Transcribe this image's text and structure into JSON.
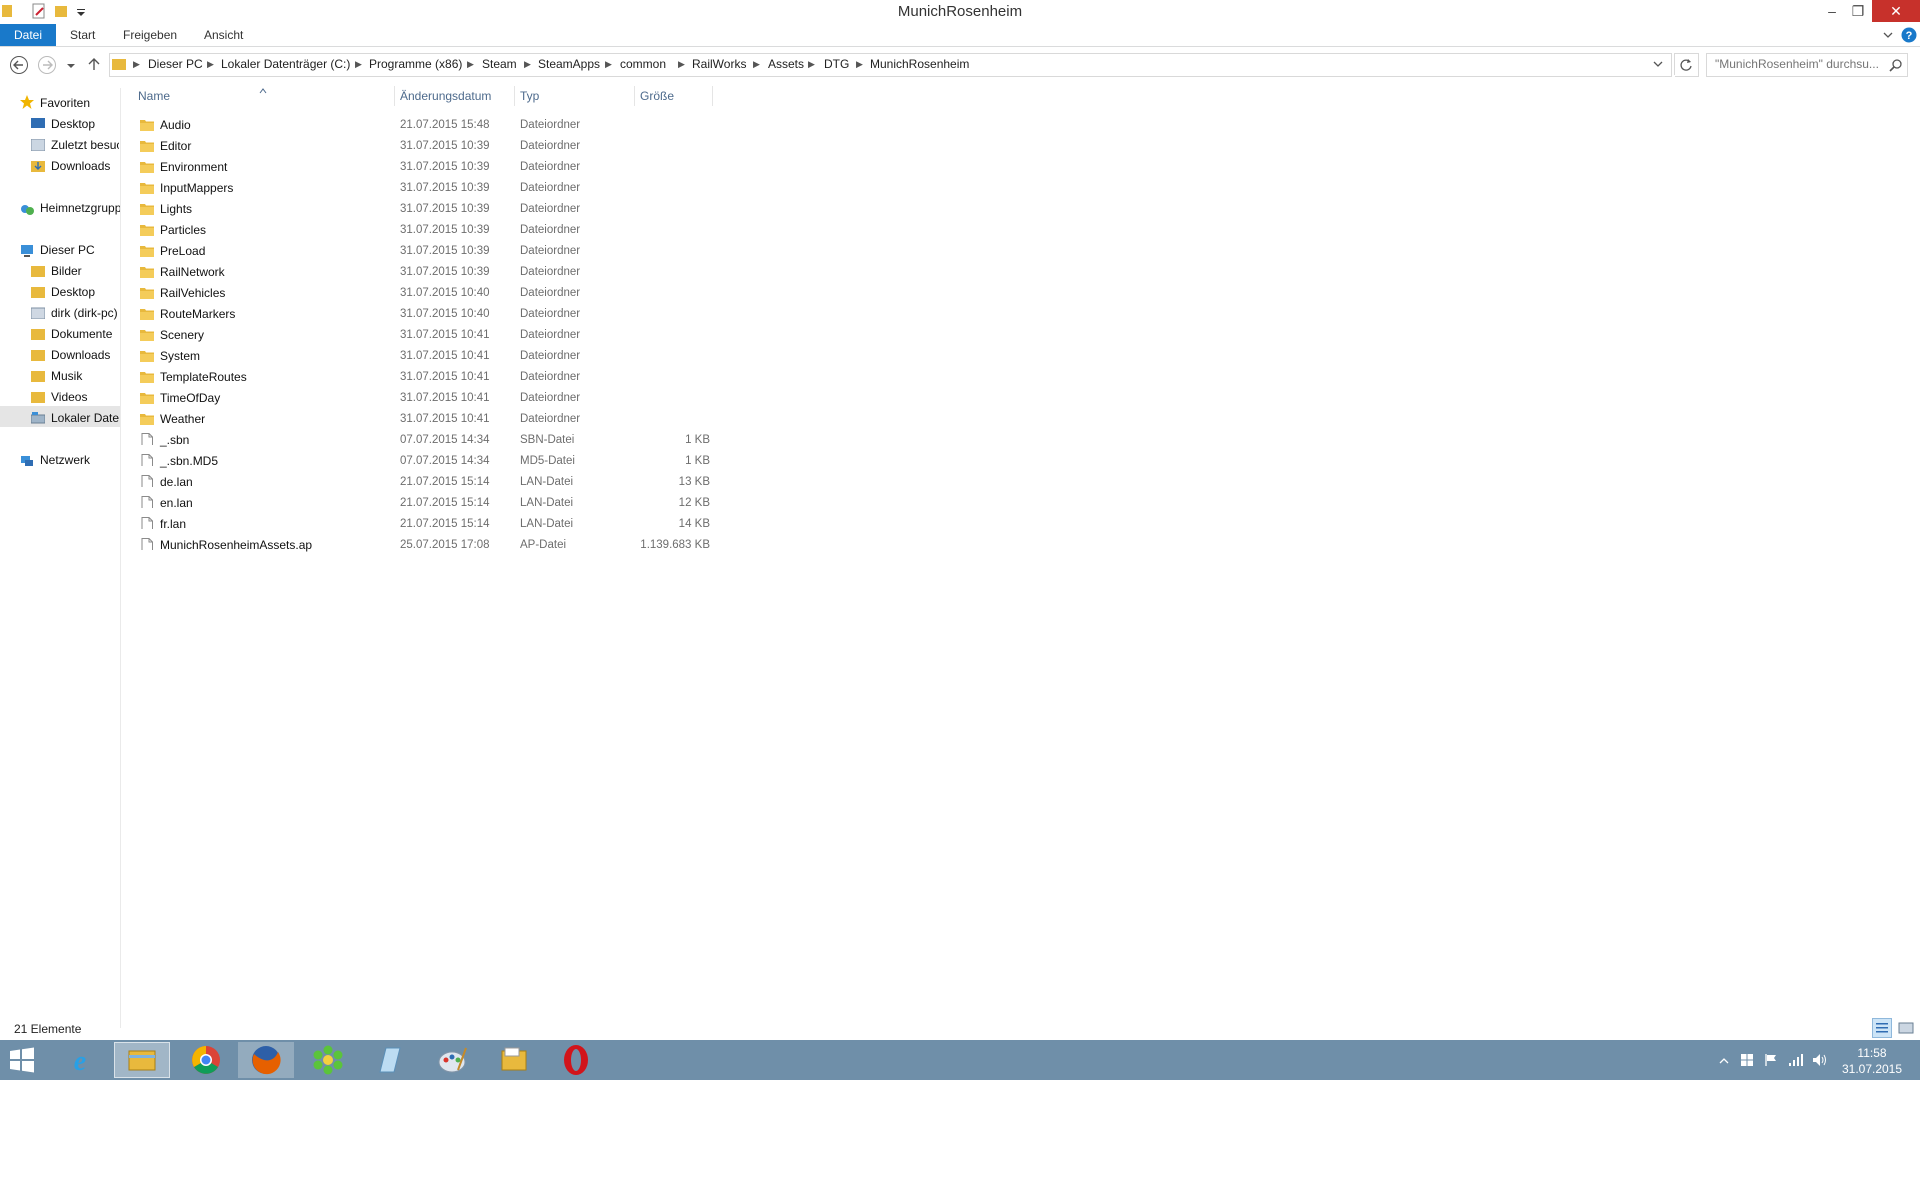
{
  "window": {
    "title": "MunichRosenheim"
  },
  "ribbon": {
    "tabs": [
      "Datei",
      "Start",
      "Freigeben",
      "Ansicht"
    ]
  },
  "address": {
    "crumbs": [
      "Dieser PC",
      "Lokaler Datenträger (C:)",
      "Programme (x86)",
      "Steam",
      "SteamApps",
      "common",
      "RailWorks",
      "Assets",
      "DTG",
      "MunichRosenheim"
    ]
  },
  "search": {
    "placeholder": "\"MunichRosenheim\" durchsu..."
  },
  "nav": {
    "favorites_label": "Favoriten",
    "favorites": [
      "Desktop",
      "Zuletzt besuc",
      "Downloads"
    ],
    "homegroup": "Heimnetzgrupp",
    "thispc_label": "Dieser PC",
    "thispc": [
      "Bilder",
      "Desktop",
      "dirk (dirk-pc)",
      "Dokumente",
      "Downloads",
      "Musik",
      "Videos",
      "Lokaler Daten"
    ],
    "network": "Netzwerk"
  },
  "columns": {
    "name": "Name",
    "date": "Änderungsdatum",
    "type": "Typ",
    "size": "Größe"
  },
  "files": [
    {
      "name": "Audio",
      "date": "21.07.2015 15:48",
      "type": "Dateiordner",
      "size": "",
      "kind": "folder"
    },
    {
      "name": "Editor",
      "date": "31.07.2015 10:39",
      "type": "Dateiordner",
      "size": "",
      "kind": "folder"
    },
    {
      "name": "Environment",
      "date": "31.07.2015 10:39",
      "type": "Dateiordner",
      "size": "",
      "kind": "folder"
    },
    {
      "name": "InputMappers",
      "date": "31.07.2015 10:39",
      "type": "Dateiordner",
      "size": "",
      "kind": "folder"
    },
    {
      "name": "Lights",
      "date": "31.07.2015 10:39",
      "type": "Dateiordner",
      "size": "",
      "kind": "folder"
    },
    {
      "name": "Particles",
      "date": "31.07.2015 10:39",
      "type": "Dateiordner",
      "size": "",
      "kind": "folder"
    },
    {
      "name": "PreLoad",
      "date": "31.07.2015 10:39",
      "type": "Dateiordner",
      "size": "",
      "kind": "folder"
    },
    {
      "name": "RailNetwork",
      "date": "31.07.2015 10:39",
      "type": "Dateiordner",
      "size": "",
      "kind": "folder"
    },
    {
      "name": "RailVehicles",
      "date": "31.07.2015 10:40",
      "type": "Dateiordner",
      "size": "",
      "kind": "folder"
    },
    {
      "name": "RouteMarkers",
      "date": "31.07.2015 10:40",
      "type": "Dateiordner",
      "size": "",
      "kind": "folder"
    },
    {
      "name": "Scenery",
      "date": "31.07.2015 10:41",
      "type": "Dateiordner",
      "size": "",
      "kind": "folder"
    },
    {
      "name": "System",
      "date": "31.07.2015 10:41",
      "type": "Dateiordner",
      "size": "",
      "kind": "folder"
    },
    {
      "name": "TemplateRoutes",
      "date": "31.07.2015 10:41",
      "type": "Dateiordner",
      "size": "",
      "kind": "folder"
    },
    {
      "name": "TimeOfDay",
      "date": "31.07.2015 10:41",
      "type": "Dateiordner",
      "size": "",
      "kind": "folder"
    },
    {
      "name": "Weather",
      "date": "31.07.2015 10:41",
      "type": "Dateiordner",
      "size": "",
      "kind": "folder"
    },
    {
      "name": "_.sbn",
      "date": "07.07.2015 14:34",
      "type": "SBN-Datei",
      "size": "1 KB",
      "kind": "file"
    },
    {
      "name": "_.sbn.MD5",
      "date": "07.07.2015 14:34",
      "type": "MD5-Datei",
      "size": "1 KB",
      "kind": "file"
    },
    {
      "name": "de.lan",
      "date": "21.07.2015 15:14",
      "type": "LAN-Datei",
      "size": "13 KB",
      "kind": "file"
    },
    {
      "name": "en.lan",
      "date": "21.07.2015 15:14",
      "type": "LAN-Datei",
      "size": "12 KB",
      "kind": "file"
    },
    {
      "name": "fr.lan",
      "date": "21.07.2015 15:14",
      "type": "LAN-Datei",
      "size": "14 KB",
      "kind": "file"
    },
    {
      "name": "MunichRosenheimAssets.ap",
      "date": "25.07.2015 17:08",
      "type": "AP-Datei",
      "size": "1.139.683 KB",
      "kind": "file"
    }
  ],
  "status": {
    "count": "21 Elemente"
  },
  "taskbar": {
    "apps": [
      "internet-explorer-icon",
      "file-explorer-icon",
      "chrome-icon",
      "firefox-icon",
      "icq-icon",
      "notepad-icon",
      "paint-icon",
      "folder-app-icon",
      "opera-icon"
    ],
    "time": "11:58",
    "date": "31.07.2015"
  },
  "colors": {
    "accent": "#1979ca",
    "taskbar": "#6f8fa9",
    "folder": "#e8b93d",
    "close": "#c7312b"
  }
}
